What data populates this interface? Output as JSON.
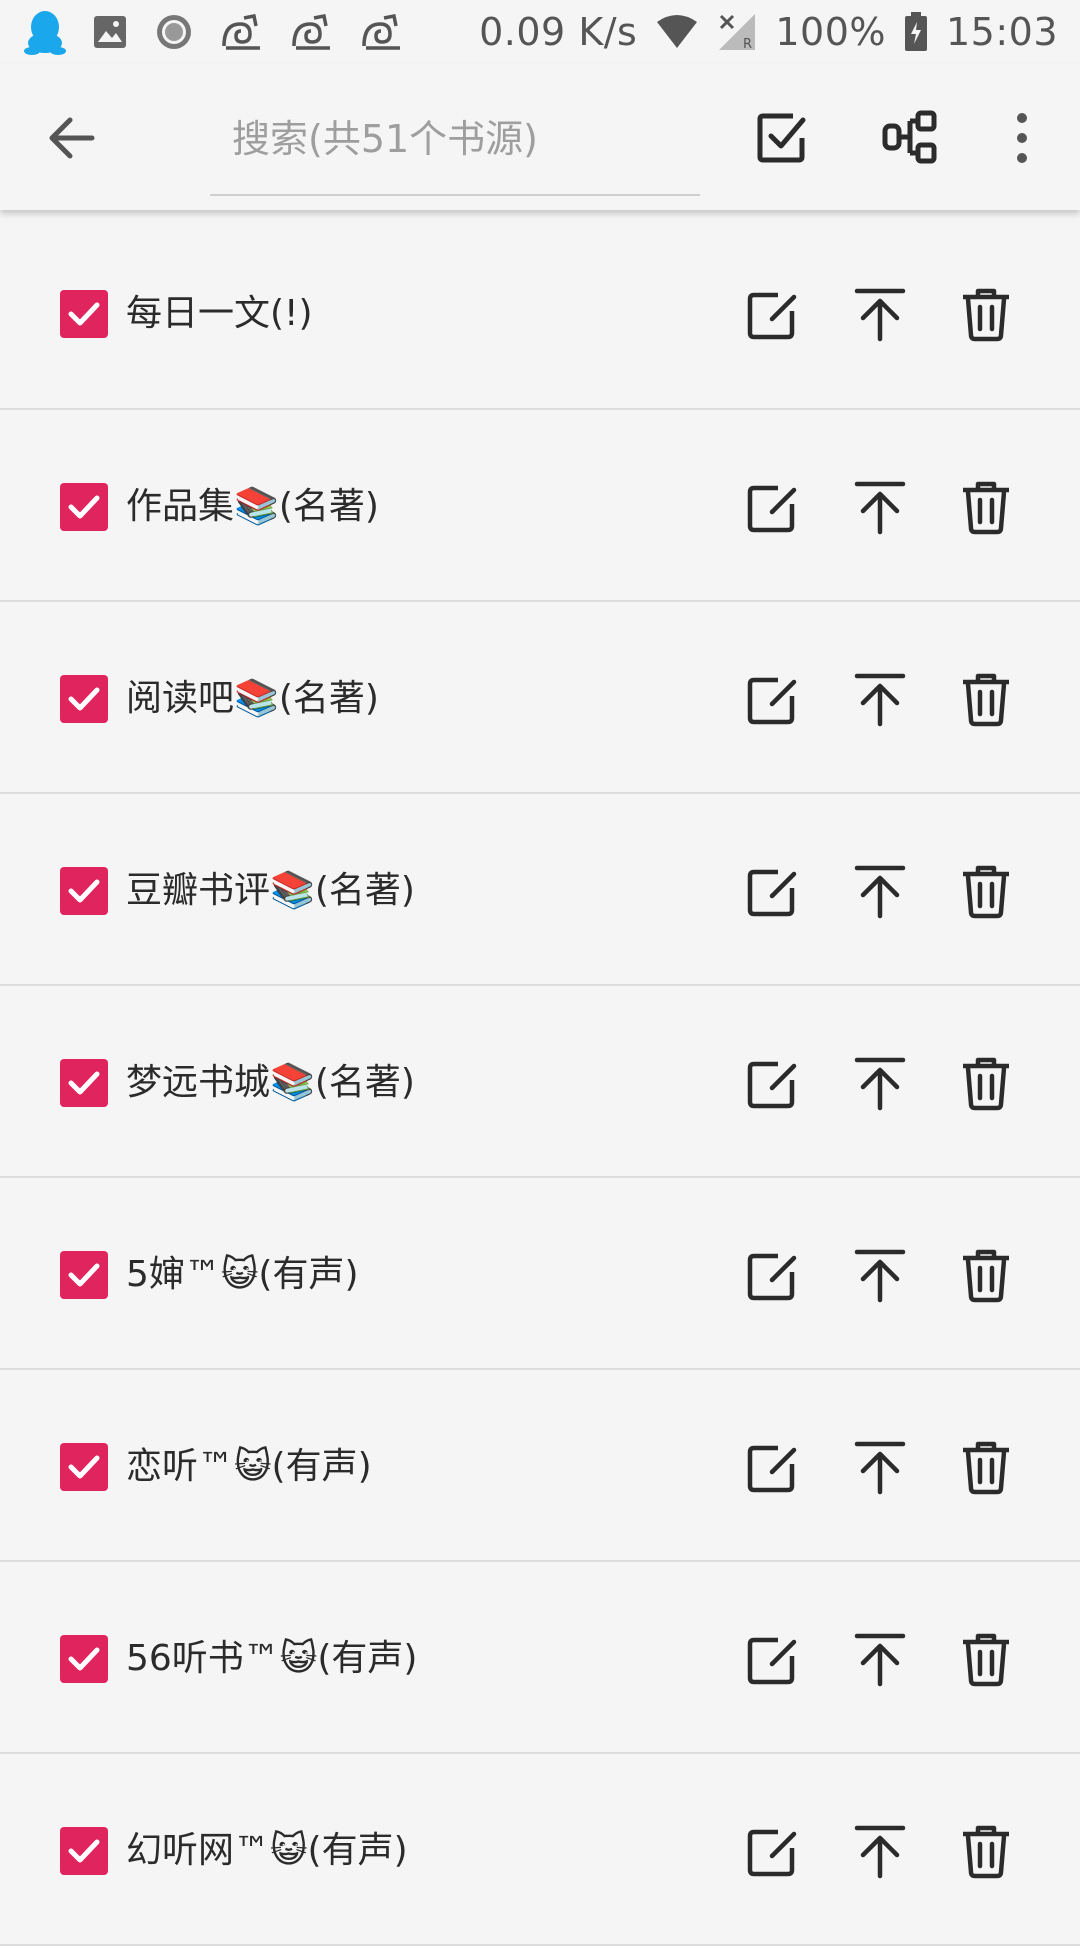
{
  "status_bar": {
    "left_icons": [
      "qq-icon",
      "image-icon",
      "record-icon",
      "uc-browser-icon",
      "uc-browser-icon",
      "uc-browser-icon"
    ],
    "net_speed": "0.09 K/s",
    "battery": "100%",
    "time": "15:03",
    "right_icons": [
      "wifi-icon",
      "signal-off-icon",
      "battery-icon"
    ]
  },
  "toolbar": {
    "search_placeholder": "搜索(共51个书源)",
    "icons": [
      "back-arrow-icon",
      "select-all-icon",
      "group-icon",
      "more-vert-icon"
    ]
  },
  "sources": [
    {
      "label": "每日一文(!)",
      "checked": true
    },
    {
      "label": "作品集📚(名著)",
      "checked": true
    },
    {
      "label": "阅读吧📚(名著)",
      "checked": true
    },
    {
      "label": "豆瓣书评📚(名著)",
      "checked": true
    },
    {
      "label": "梦远书城📚(名著)",
      "checked": true
    },
    {
      "label": "5婶™😺(有声)",
      "checked": true
    },
    {
      "label": "恋听™😺(有声)",
      "checked": true
    },
    {
      "label": "56听书™😺(有声)",
      "checked": true
    },
    {
      "label": "幻听网™😺(有声)",
      "checked": true
    }
  ],
  "row_icons": [
    "edit-icon",
    "move-to-top-icon",
    "delete-icon"
  ],
  "colors": {
    "accent": "#e0245e",
    "background": "#f5f5f5",
    "divider": "#dcdcdc",
    "icon": "#2b2b2b"
  }
}
